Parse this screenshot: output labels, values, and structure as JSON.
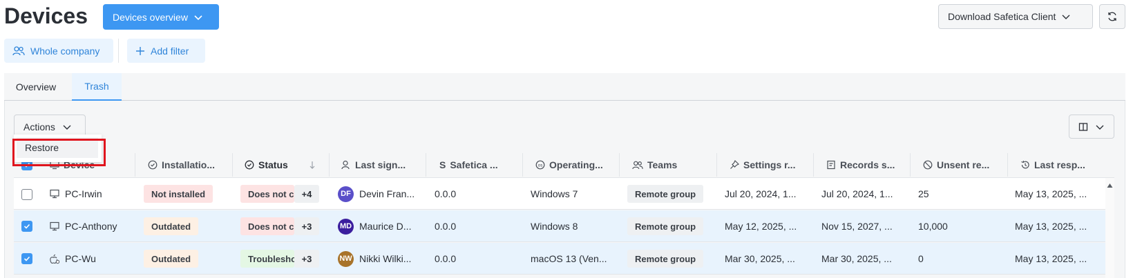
{
  "header": {
    "title": "Devices",
    "view_selector": "Devices overview",
    "download_button": "Download Safetica Client"
  },
  "filters": {
    "scope": "Whole company",
    "add_filter": "Add filter"
  },
  "tabs": [
    {
      "label": "Overview",
      "active": false
    },
    {
      "label": "Trash",
      "active": true
    }
  ],
  "toolbar": {
    "actions_label": "Actions",
    "actions_menu": [
      {
        "label": "Restore"
      }
    ]
  },
  "table": {
    "columns": [
      {
        "label": "Device",
        "icon": "device-icon"
      },
      {
        "label": "Installatio...",
        "icon": "check-circle-icon"
      },
      {
        "label": "Status",
        "icon": "check-circle-icon",
        "sort": "desc"
      },
      {
        "label": "Last sign...",
        "icon": "user-icon"
      },
      {
        "label": "Safetica ...",
        "icon": "safetica-icon"
      },
      {
        "label": "Operating...",
        "icon": "os-icon"
      },
      {
        "label": "Teams",
        "icon": "team-icon"
      },
      {
        "label": "Settings r...",
        "icon": "pin-icon"
      },
      {
        "label": "Records s...",
        "icon": "records-icon"
      },
      {
        "label": "Unsent re...",
        "icon": "block-icon"
      },
      {
        "label": "Last resp...",
        "icon": "history-icon"
      }
    ],
    "rows": [
      {
        "selected": false,
        "device": "PC-Irwin",
        "device_icon": "windows-pc-icon",
        "installation": "Not installed",
        "installation_color": "red",
        "status": "Does not c",
        "status_color": "red",
        "status_more": "+4",
        "user_initials": "DF",
        "user_color": "#5a4fc9",
        "user": "Devin Fran...",
        "version": "0.0.0",
        "os": "Windows 7",
        "team": "Remote group",
        "settings": "Jul 20, 2024, 1...",
        "records": "Jul 20, 2024, 1...",
        "unsent": "25",
        "last_response": "May 13, 2025, ..."
      },
      {
        "selected": true,
        "device": "PC-Anthony",
        "device_icon": "windows-pc-icon",
        "installation": "Outdated",
        "installation_color": "orange",
        "status": "Does not c",
        "status_color": "red",
        "status_more": "+3",
        "user_initials": "MD",
        "user_color": "#3b1e9e",
        "user": "Maurice D...",
        "version": "0.0.0",
        "os": "Windows 8",
        "team": "Remote group",
        "settings": "May 12, 2025, ...",
        "records": "Nov 15, 2027, ...",
        "unsent": "10,000",
        "last_response": "May 13, 2025, ..."
      },
      {
        "selected": true,
        "device": "PC-Wu",
        "device_icon": "mac-pc-icon",
        "installation": "Outdated",
        "installation_color": "orange",
        "status": "Troublesho",
        "status_color": "green",
        "status_more": "+3",
        "user_initials": "NW",
        "user_color": "#a8732a",
        "user": "Nikki Wilki...",
        "version": "0.0.0",
        "os": "macOS 13 (Ven...",
        "team": "Remote group",
        "settings": "Mar 30, 2025, ...",
        "records": "Mar 30, 2025, ...",
        "unsent": "0",
        "last_response": "May 13, 2025, ..."
      }
    ]
  }
}
